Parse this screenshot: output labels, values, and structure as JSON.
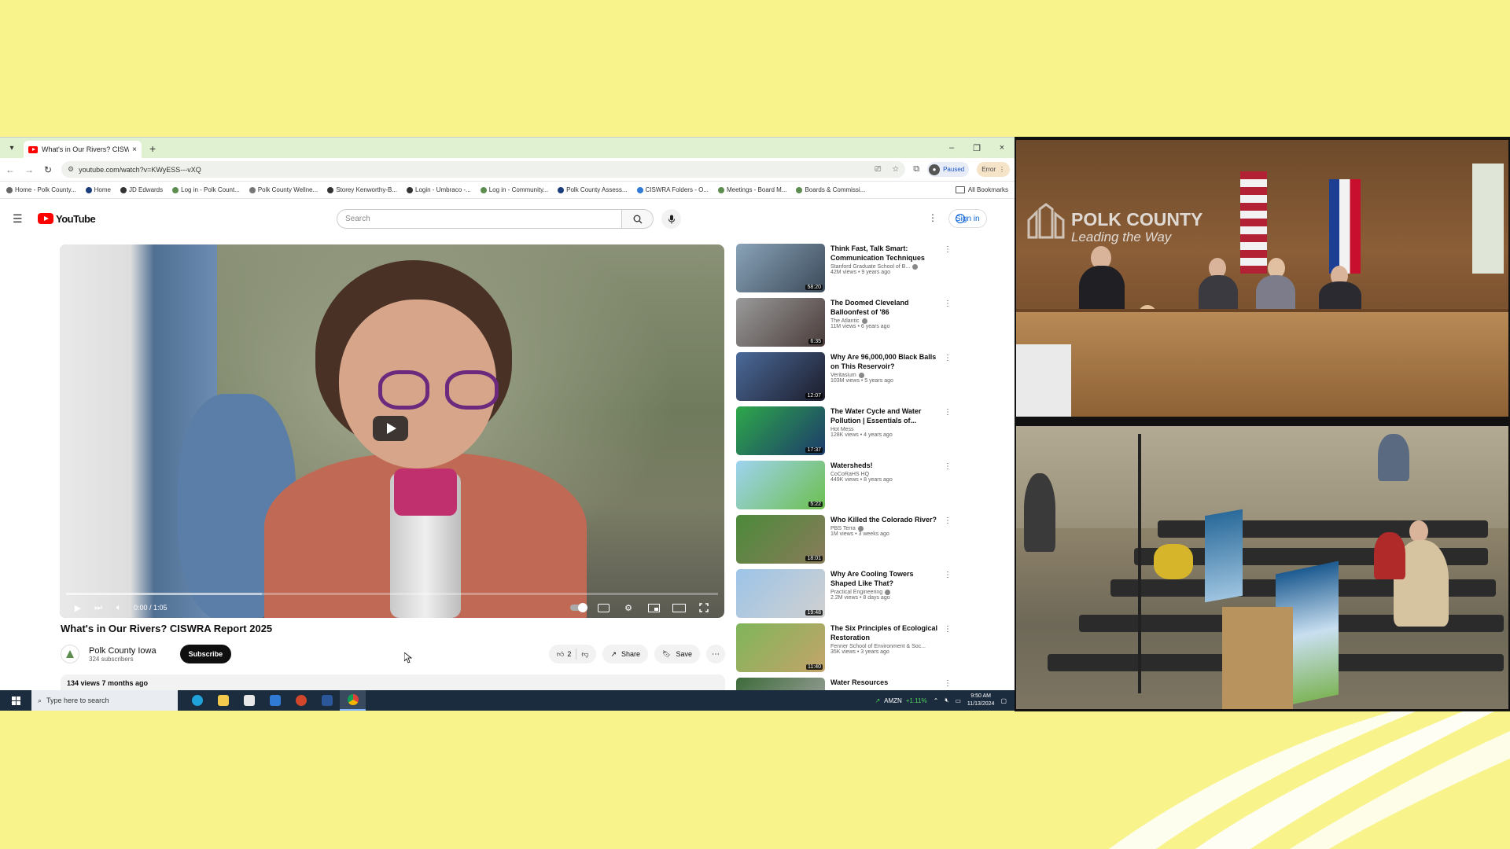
{
  "browser": {
    "tab_title": "What's in Our Rivers? CISWRA",
    "tab_close": "×",
    "new_tab": "+",
    "window_controls": [
      "–",
      "❐",
      "×"
    ],
    "url": "youtube.com/watch?v=KWyESS---vXQ",
    "profile_status": "Paused",
    "error_label": "Error",
    "bookmarks": [
      "Home - Polk County...",
      "Home",
      "JD Edwards",
      "Log in - Polk Count...",
      "Polk County Wellne...",
      "Storey Kenworthy-B...",
      "Login - Umbraco -...",
      "Log in - Community...",
      "Polk County Assess...",
      "CISWRA Folders - O...",
      "Meetings - Board M...",
      "Boards & Commissi..."
    ],
    "all_bookmarks": "All Bookmarks"
  },
  "youtube": {
    "logo_text": "YouTube",
    "search_placeholder": "Search",
    "sign_in": "Sign in",
    "video": {
      "title": "What's in Our Rivers? CISWRA Report 2025",
      "time": "0:00 / 1:05",
      "channel": "Polk County Iowa",
      "subscribers": "324 subscribers",
      "subscribe": "Subscribe",
      "likes": "2",
      "share": "Share",
      "save": "Save",
      "views_date": "134 views  7 months ago"
    },
    "recommendations": [
      {
        "title": "Think Fast, Talk Smart: Communication Techniques",
        "channel": "Stanford Graduate School of B...",
        "verified": true,
        "meta": "42M views • 9 years ago",
        "duration": "58:20",
        "color1": "#8aa3b8",
        "color2": "#3b4a5a"
      },
      {
        "title": "The Doomed Cleveland Balloonfest of '86",
        "channel": "The Atlantic",
        "verified": true,
        "meta": "11M views • 6 years ago",
        "duration": "6:35",
        "color1": "#9a9a9a",
        "color2": "#4a3c3a"
      },
      {
        "title": "Why Are 96,000,000 Black Balls on This Reservoir?",
        "channel": "Veritasium",
        "verified": true,
        "meta": "103M views • 5 years ago",
        "duration": "12:07",
        "color1": "#4b6a9a",
        "color2": "#1c1c2a"
      },
      {
        "title": "The Water Cycle and Water Pollution | Essentials of...",
        "channel": "Hot Mess",
        "verified": false,
        "meta": "128K views • 4 years ago",
        "duration": "17:37",
        "color1": "#2ea84a",
        "color2": "#1c3b6b"
      },
      {
        "title": "Watersheds!",
        "channel": "CoCoRaHS HQ",
        "verified": false,
        "meta": "449K views • 8 years ago",
        "duration": "5:22",
        "color1": "#9fd3f0",
        "color2": "#6cbf4f"
      },
      {
        "title": "Who Killed the Colorado River?",
        "channel": "PBS Terra",
        "verified": true,
        "meta": "1M views • 3 weeks ago",
        "duration": "18:01",
        "color1": "#4b8a3a",
        "color2": "#8a7b5a"
      },
      {
        "title": "Why Are Cooling Towers Shaped Like That?",
        "channel": "Practical Engineering",
        "verified": true,
        "meta": "2.2M views • 8 days ago",
        "duration": "19:48",
        "color1": "#9cc4e8",
        "color2": "#d0d0d0"
      },
      {
        "title": "The Six Principles of Ecological Restoration",
        "channel": "Fenner School of Environment & Soc...",
        "verified": false,
        "meta": "35K views • 3 years ago",
        "duration": "11:40",
        "color1": "#7fb55a",
        "color2": "#c4a46a"
      },
      {
        "title": "Water Resources",
        "channel": "",
        "verified": false,
        "meta": "",
        "duration": "",
        "color1": "#3d6b3a",
        "color2": "#a8a8a8"
      }
    ]
  },
  "taskbar": {
    "search_placeholder": "Type here to search",
    "stock": "AMZN",
    "stock_change": "+1.11%",
    "time": "9:50 AM",
    "date": "11/13/2024"
  },
  "camera": {
    "logo_line1": "POLK COUNTY",
    "logo_line2": "Leading the Way"
  },
  "colors": {
    "background": "#f9f38c",
    "youtube_red": "#ff0000",
    "link_blue": "#065fd4"
  }
}
